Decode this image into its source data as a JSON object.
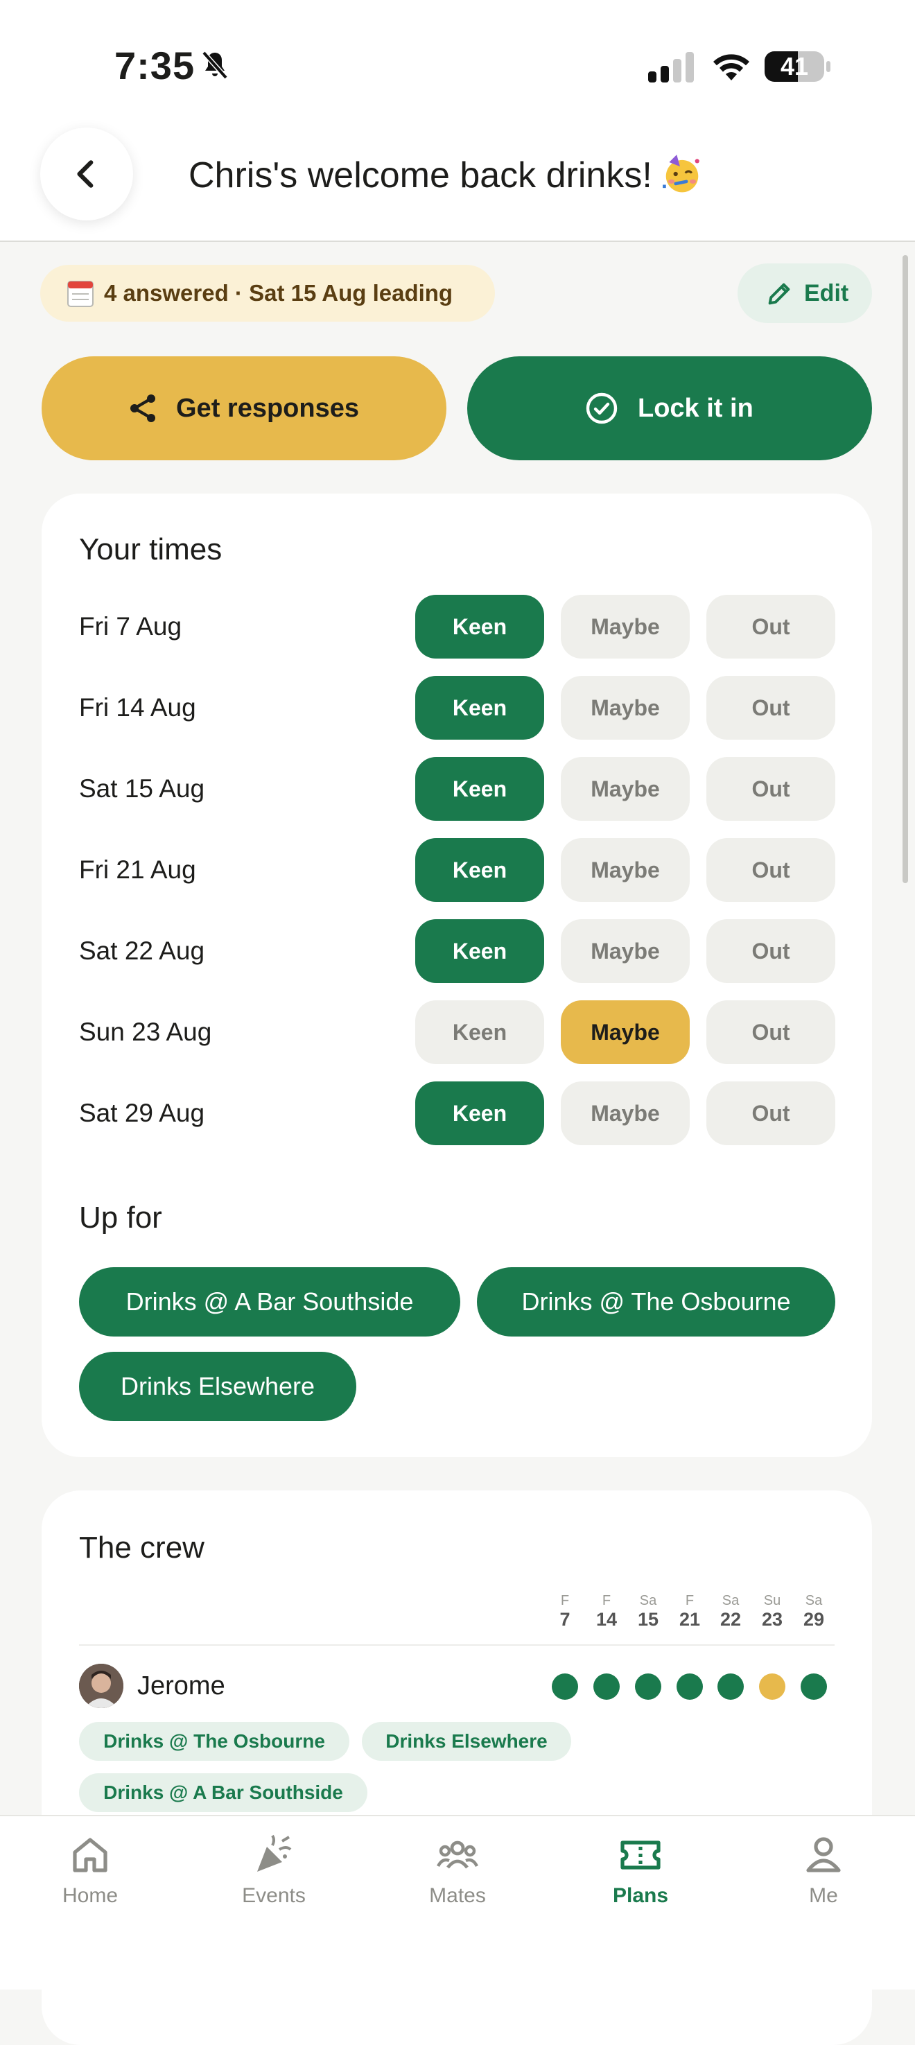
{
  "status_bar": {
    "time": "7:35",
    "battery": "41"
  },
  "header": {
    "title": "Chris's welcome back drinks!",
    "title_emoji": "partying-face-emoji"
  },
  "summary": {
    "text": "4 answered · Sat 15 Aug leading",
    "edit_label": "Edit"
  },
  "actions": {
    "get_responses_label": "Get responses",
    "lock_label": "Lock it in"
  },
  "your_times": {
    "title": "Your times",
    "options": [
      "Keen",
      "Maybe",
      "Out"
    ],
    "rows": [
      {
        "date": "Fri 7 Aug",
        "selected": "Keen"
      },
      {
        "date": "Fri 14 Aug",
        "selected": "Keen"
      },
      {
        "date": "Sat 15 Aug",
        "selected": "Keen"
      },
      {
        "date": "Fri 21 Aug",
        "selected": "Keen"
      },
      {
        "date": "Sat 22 Aug",
        "selected": "Keen"
      },
      {
        "date": "Sun 23 Aug",
        "selected": "Maybe"
      },
      {
        "date": "Sat 29 Aug",
        "selected": "Keen"
      }
    ]
  },
  "up_for": {
    "title": "Up for",
    "chips": [
      "Drinks @ A Bar Southside",
      "Drinks @ The Osbourne",
      "Drinks Elsewhere"
    ]
  },
  "crew": {
    "title": "The crew",
    "columns": [
      {
        "day": "F",
        "num": "7"
      },
      {
        "day": "F",
        "num": "14"
      },
      {
        "day": "Sa",
        "num": "15"
      },
      {
        "day": "F",
        "num": "21"
      },
      {
        "day": "Sa",
        "num": "22"
      },
      {
        "day": "Su",
        "num": "23"
      },
      {
        "day": "Sa",
        "num": "29"
      }
    ],
    "members": [
      {
        "name": "Jerome",
        "answers": [
          "Keen",
          "Keen",
          "Keen",
          "Keen",
          "Keen",
          "Maybe",
          "Keen"
        ],
        "tags": [
          "Drinks @ The Osbourne",
          "Drinks Elsewhere",
          "Drinks @ A Bar Southside"
        ]
      }
    ]
  },
  "tabbar": {
    "tabs": [
      {
        "label": "Home",
        "icon": "home-icon"
      },
      {
        "label": "Events",
        "icon": "party-popper-icon"
      },
      {
        "label": "Mates",
        "icon": "people-icon"
      },
      {
        "label": "Plans",
        "icon": "ticket-icon",
        "active": true
      },
      {
        "label": "Me",
        "icon": "person-icon"
      }
    ]
  },
  "colors": {
    "green": "#1a7a4d",
    "yellow": "#e7b94c",
    "pill_bg": "#efefeb"
  }
}
